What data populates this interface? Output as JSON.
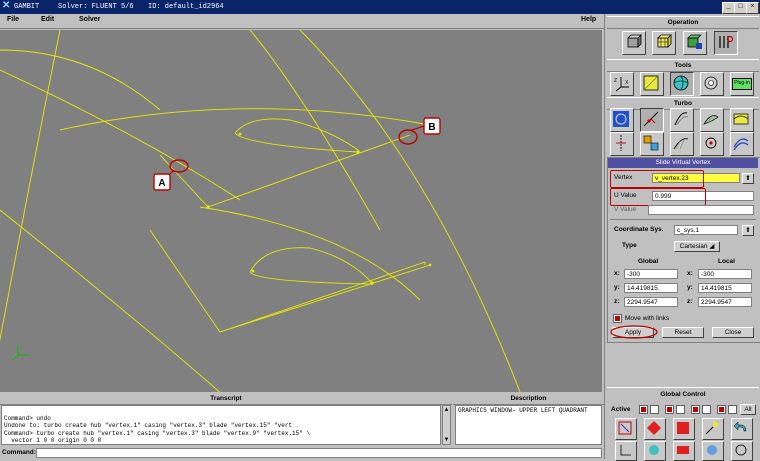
{
  "window": {
    "app": "GAMBIT",
    "solver": "Solver: FLUENT 5/6",
    "id": "ID: default_id2964"
  },
  "menu": {
    "file": "File",
    "edit": "Edit",
    "solver": "Solver",
    "help": "Help"
  },
  "viewport": {
    "marker_a": "A",
    "marker_b": "B",
    "colors": {
      "background": "#808080",
      "geometry": "#e8e800",
      "annotation": "#c00000"
    }
  },
  "panel": {
    "operation": "Operation",
    "tools": "Tools",
    "turbo": "Turbo",
    "plugin_label": "Plug-in",
    "slide_virtual_vertex": {
      "title": "Slide Virtual Vertex",
      "vertex_label": "Vertex",
      "vertex_value": "v_vertex.23",
      "u_value_label": "U Value",
      "u_value_value": "0.999",
      "v_value_label": "V Value",
      "v_value_value": "",
      "coord_sys_label": "Coordinate Sys.",
      "coord_sys_value": "c_sys.1",
      "type_label": "Type",
      "type_value": "Cartesian",
      "global_label": "Global",
      "local_label": "Local",
      "global": {
        "x_label": "x:",
        "x": "-300",
        "y_label": "y:",
        "y": "14.419815",
        "z_label": "z:",
        "z": "2294.9547"
      },
      "local": {
        "x_label": "x:",
        "x": "-300",
        "y_label": "y:",
        "y": "14.419815",
        "z_label": "z:",
        "z": "2294.9547"
      },
      "move_with_links": "Move with links",
      "apply": "Apply",
      "reset": "Reset",
      "close": "Close"
    },
    "global_control": "Global Control",
    "active_label": "Active",
    "all_label": "All"
  },
  "transcript": {
    "title": "Transcript",
    "lines": [
      "Command> undo",
      "Undone to: turbo create hub \"vertex.1\" casing \"vertex.3\" blade \"vertex.15\" \"vert",
      "Command> turbo create hub \"vertex.1\" casing \"vertex.3\" blade \"vertex.9\" \"vertex.15\" \\",
      "  vector 1 0 0 origin 0 0 0"
    ]
  },
  "description": {
    "title": "Description",
    "text": "GRAPHICS WINDOW- UPPER LEFT QUADRANT"
  },
  "command": {
    "label": "Command:",
    "value": ""
  }
}
